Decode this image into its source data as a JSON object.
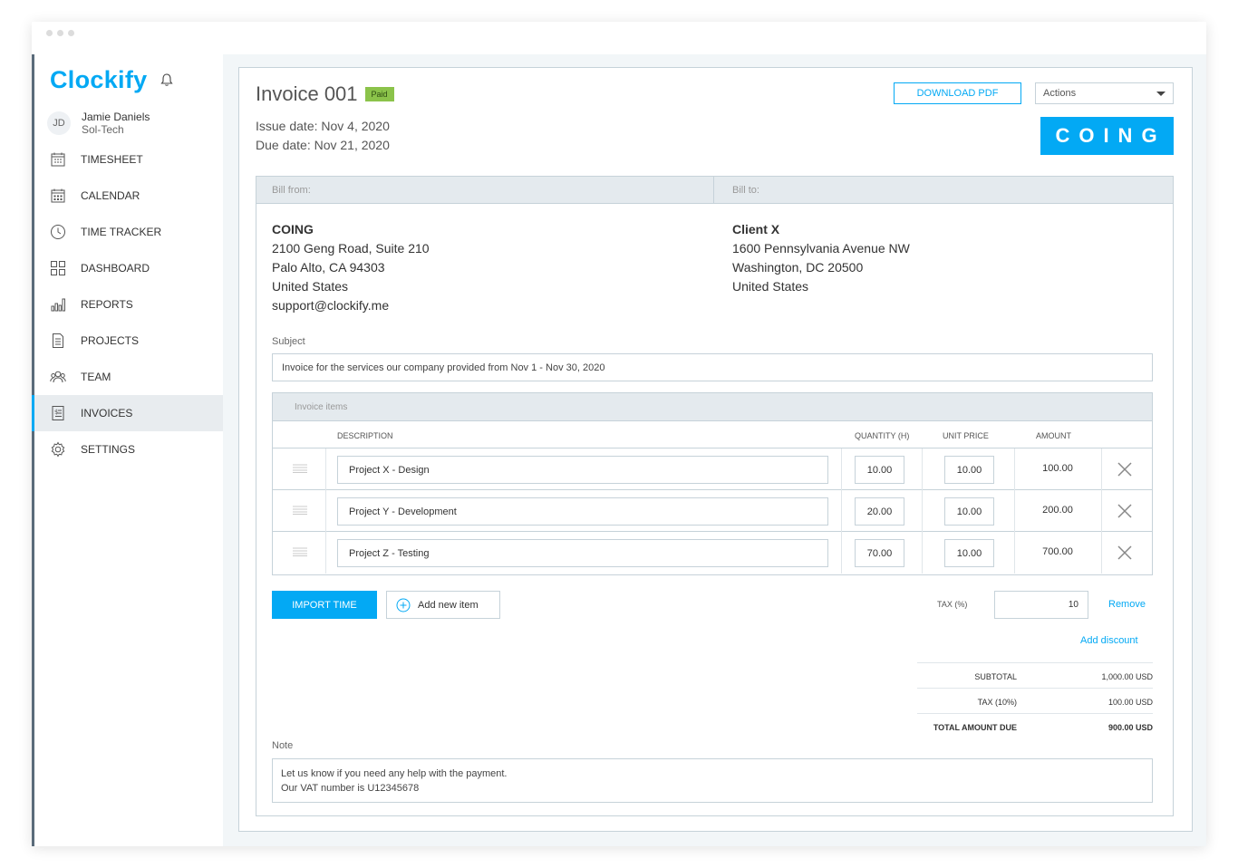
{
  "app": {
    "logo": "Clockify"
  },
  "user": {
    "initials": "JD",
    "name": "Jamie Daniels",
    "org": "Sol-Tech"
  },
  "nav": [
    {
      "label": "TIMESHEET",
      "icon": "timesheet-icon"
    },
    {
      "label": "CALENDAR",
      "icon": "calendar-icon"
    },
    {
      "label": "TIME TRACKER",
      "icon": "clock-icon"
    },
    {
      "label": "DASHBOARD",
      "icon": "dashboard-icon"
    },
    {
      "label": "REPORTS",
      "icon": "reports-icon"
    },
    {
      "label": "PROJECTS",
      "icon": "projects-icon"
    },
    {
      "label": "TEAM",
      "icon": "team-icon"
    },
    {
      "label": "INVOICES",
      "icon": "invoice-icon",
      "active": true
    },
    {
      "label": "SETTINGS",
      "icon": "gear-icon"
    }
  ],
  "invoice": {
    "title": "Invoice 001",
    "status": "Paid",
    "issue_date": "Issue date: Nov 4, 2020",
    "due_date": "Due date: Nov 21, 2020",
    "download_label": "DOWNLOAD PDF",
    "actions_label": "Actions",
    "company_logo": "COING",
    "bill_from_label": "Bill from:",
    "bill_to_label": "Bill to:",
    "from": {
      "name": "COING",
      "line1": "2100 Geng Road, Suite 210",
      "line2": "Palo Alto, CA 94303",
      "line3": "United States",
      "line4": "support@clockify.me"
    },
    "to": {
      "name": "Client X",
      "line1": "1600 Pennsylvania Avenue NW",
      "line2": "Washington, DC 20500",
      "line3": "United States"
    },
    "subject_label": "Subject",
    "subject": "Invoice for the services our company provided from Nov 1 - Nov 30, 2020",
    "items_label": "Invoice items",
    "columns": {
      "description": "DESCRIPTION",
      "quantity": "QUANTITY (H)",
      "unit_price": "UNIT PRICE",
      "amount": "AMOUNT"
    },
    "items": [
      {
        "description": "Project X - Design",
        "quantity": "10.00",
        "unit_price": "10.00",
        "amount": "100.00"
      },
      {
        "description": "Project Y - Development",
        "quantity": "20.00",
        "unit_price": "10.00",
        "amount": "200.00"
      },
      {
        "description": "Project Z - Testing",
        "quantity": "70.00",
        "unit_price": "10.00",
        "amount": "700.00"
      }
    ],
    "import_label": "IMPORT TIME",
    "add_item_label": "Add new item",
    "tax_label": "TAX (%)",
    "tax_value": "10",
    "remove_label": "Remove",
    "discount_label": "Add discount",
    "totals": {
      "subtotal_label": "SUBTOTAL",
      "subtotal": "1,000.00 USD",
      "tax_label": "TAX (10%)",
      "tax": "100.00 USD",
      "total_label": "TOTAL AMOUNT DUE",
      "total": "900.00 USD"
    },
    "note_label": "Note",
    "note_line1": "Let us know if you need any help with the payment.",
    "note_line2": "Our VAT number is U12345678"
  },
  "colors": {
    "accent": "#03a9f4",
    "paid": "#8bc34a"
  }
}
